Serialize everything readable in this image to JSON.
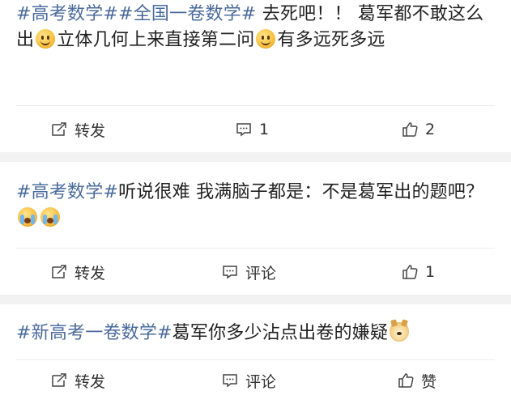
{
  "posts": [
    {
      "segments": [
        {
          "type": "hashtag",
          "text": "#高考数学#"
        },
        {
          "type": "hashtag",
          "text": "#全国一卷数学#"
        },
        {
          "type": "text",
          "text": " 去死吧！！ 葛军都不敢这么出"
        },
        {
          "type": "emoji",
          "name": "smile-emoji"
        },
        {
          "type": "text",
          "text": "立体几何上来直接第二问"
        },
        {
          "type": "emoji",
          "name": "smile-emoji"
        },
        {
          "type": "text",
          "text": "有多远死多远"
        }
      ],
      "actions": {
        "repost": "转发",
        "comment": "1",
        "like": "2"
      }
    },
    {
      "segments": [
        {
          "type": "hashtag",
          "text": "#高考数学#"
        },
        {
          "type": "text",
          "text": "听说很难 我满脑子都是：不是葛军出的题吧？ "
        },
        {
          "type": "emoji",
          "name": "cry-emoji"
        },
        {
          "type": "emoji",
          "name": "cry-emoji"
        }
      ],
      "actions": {
        "repost": "转发",
        "comment": "评论",
        "like": "1"
      }
    },
    {
      "segments": [
        {
          "type": "hashtag",
          "text": "#新高考一卷数学#"
        },
        {
          "type": "text",
          "text": "葛军你多少沾点出卷的嫌疑"
        },
        {
          "type": "emoji",
          "name": "doge-emoji"
        }
      ],
      "actions": {
        "repost": "转发",
        "comment": "评论",
        "like": "赞"
      }
    }
  ],
  "colors": {
    "hashtag": "#4a6b9c",
    "text": "#222222",
    "band": "#f2f2f2"
  },
  "icons": {
    "repost": "repost-icon",
    "comment": "comment-icon",
    "like": "like-icon"
  }
}
